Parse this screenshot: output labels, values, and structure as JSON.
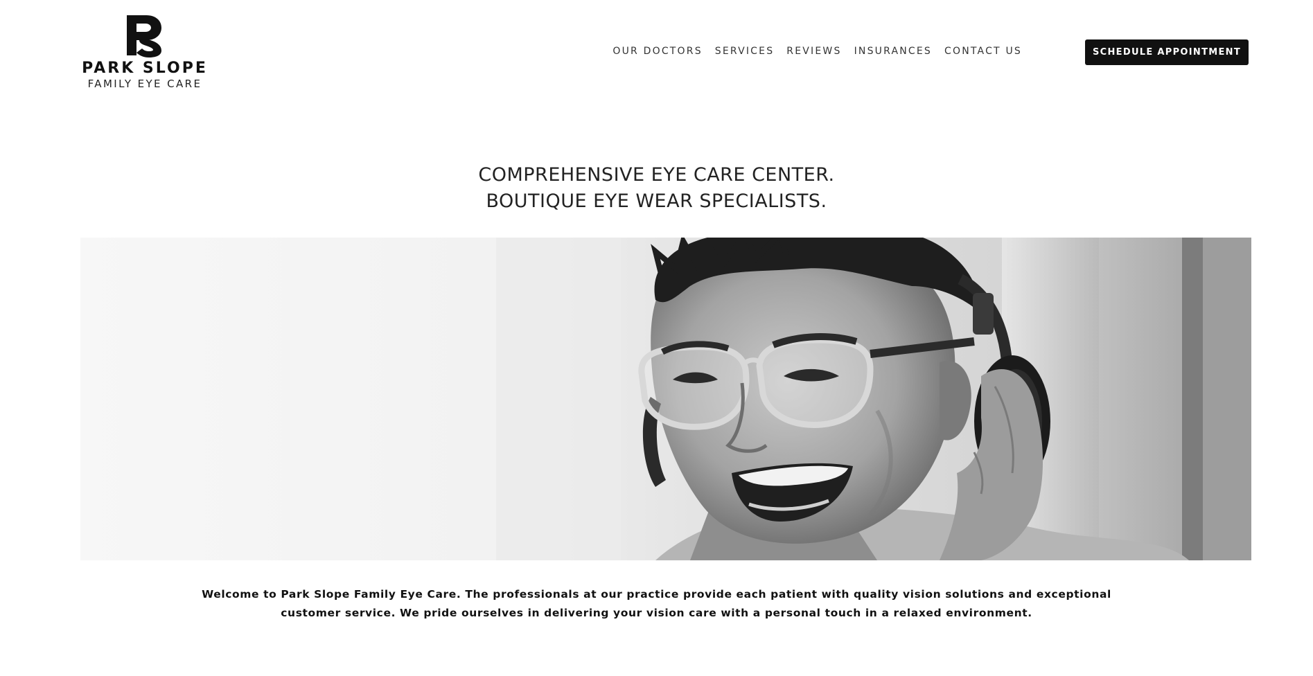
{
  "brand": {
    "name": "PARK SLOPE",
    "subtitle": "FAMILY EYE CARE",
    "monogram_icon": "ps-monogram-logo"
  },
  "nav": {
    "items": [
      {
        "label": "OUR DOCTORS"
      },
      {
        "label": "SERVICES"
      },
      {
        "label": "REVIEWS"
      },
      {
        "label": "INSURANCES"
      },
      {
        "label": "CONTACT US"
      }
    ],
    "cta_label": "SCHEDULE APPOINTMENT"
  },
  "hero": {
    "heading_line_1": "COMPREHENSIVE EYE CARE CENTER.",
    "heading_line_2": "BOUTIQUE EYE WEAR SPECIALISTS.",
    "image_subject": "smiling-man-with-glasses-and-headphones-photo"
  },
  "welcome": {
    "text": "Welcome to Park Slope Family Eye Care. The professionals at our practice provide each patient with quality vision solutions and exceptional customer service. We pride ourselves in delivering your vision care with a personal touch in a relaxed environment."
  },
  "colors": {
    "background": "#ffffff",
    "text": "#1a1a1a",
    "cta_background": "#111111",
    "cta_text": "#ffffff"
  }
}
